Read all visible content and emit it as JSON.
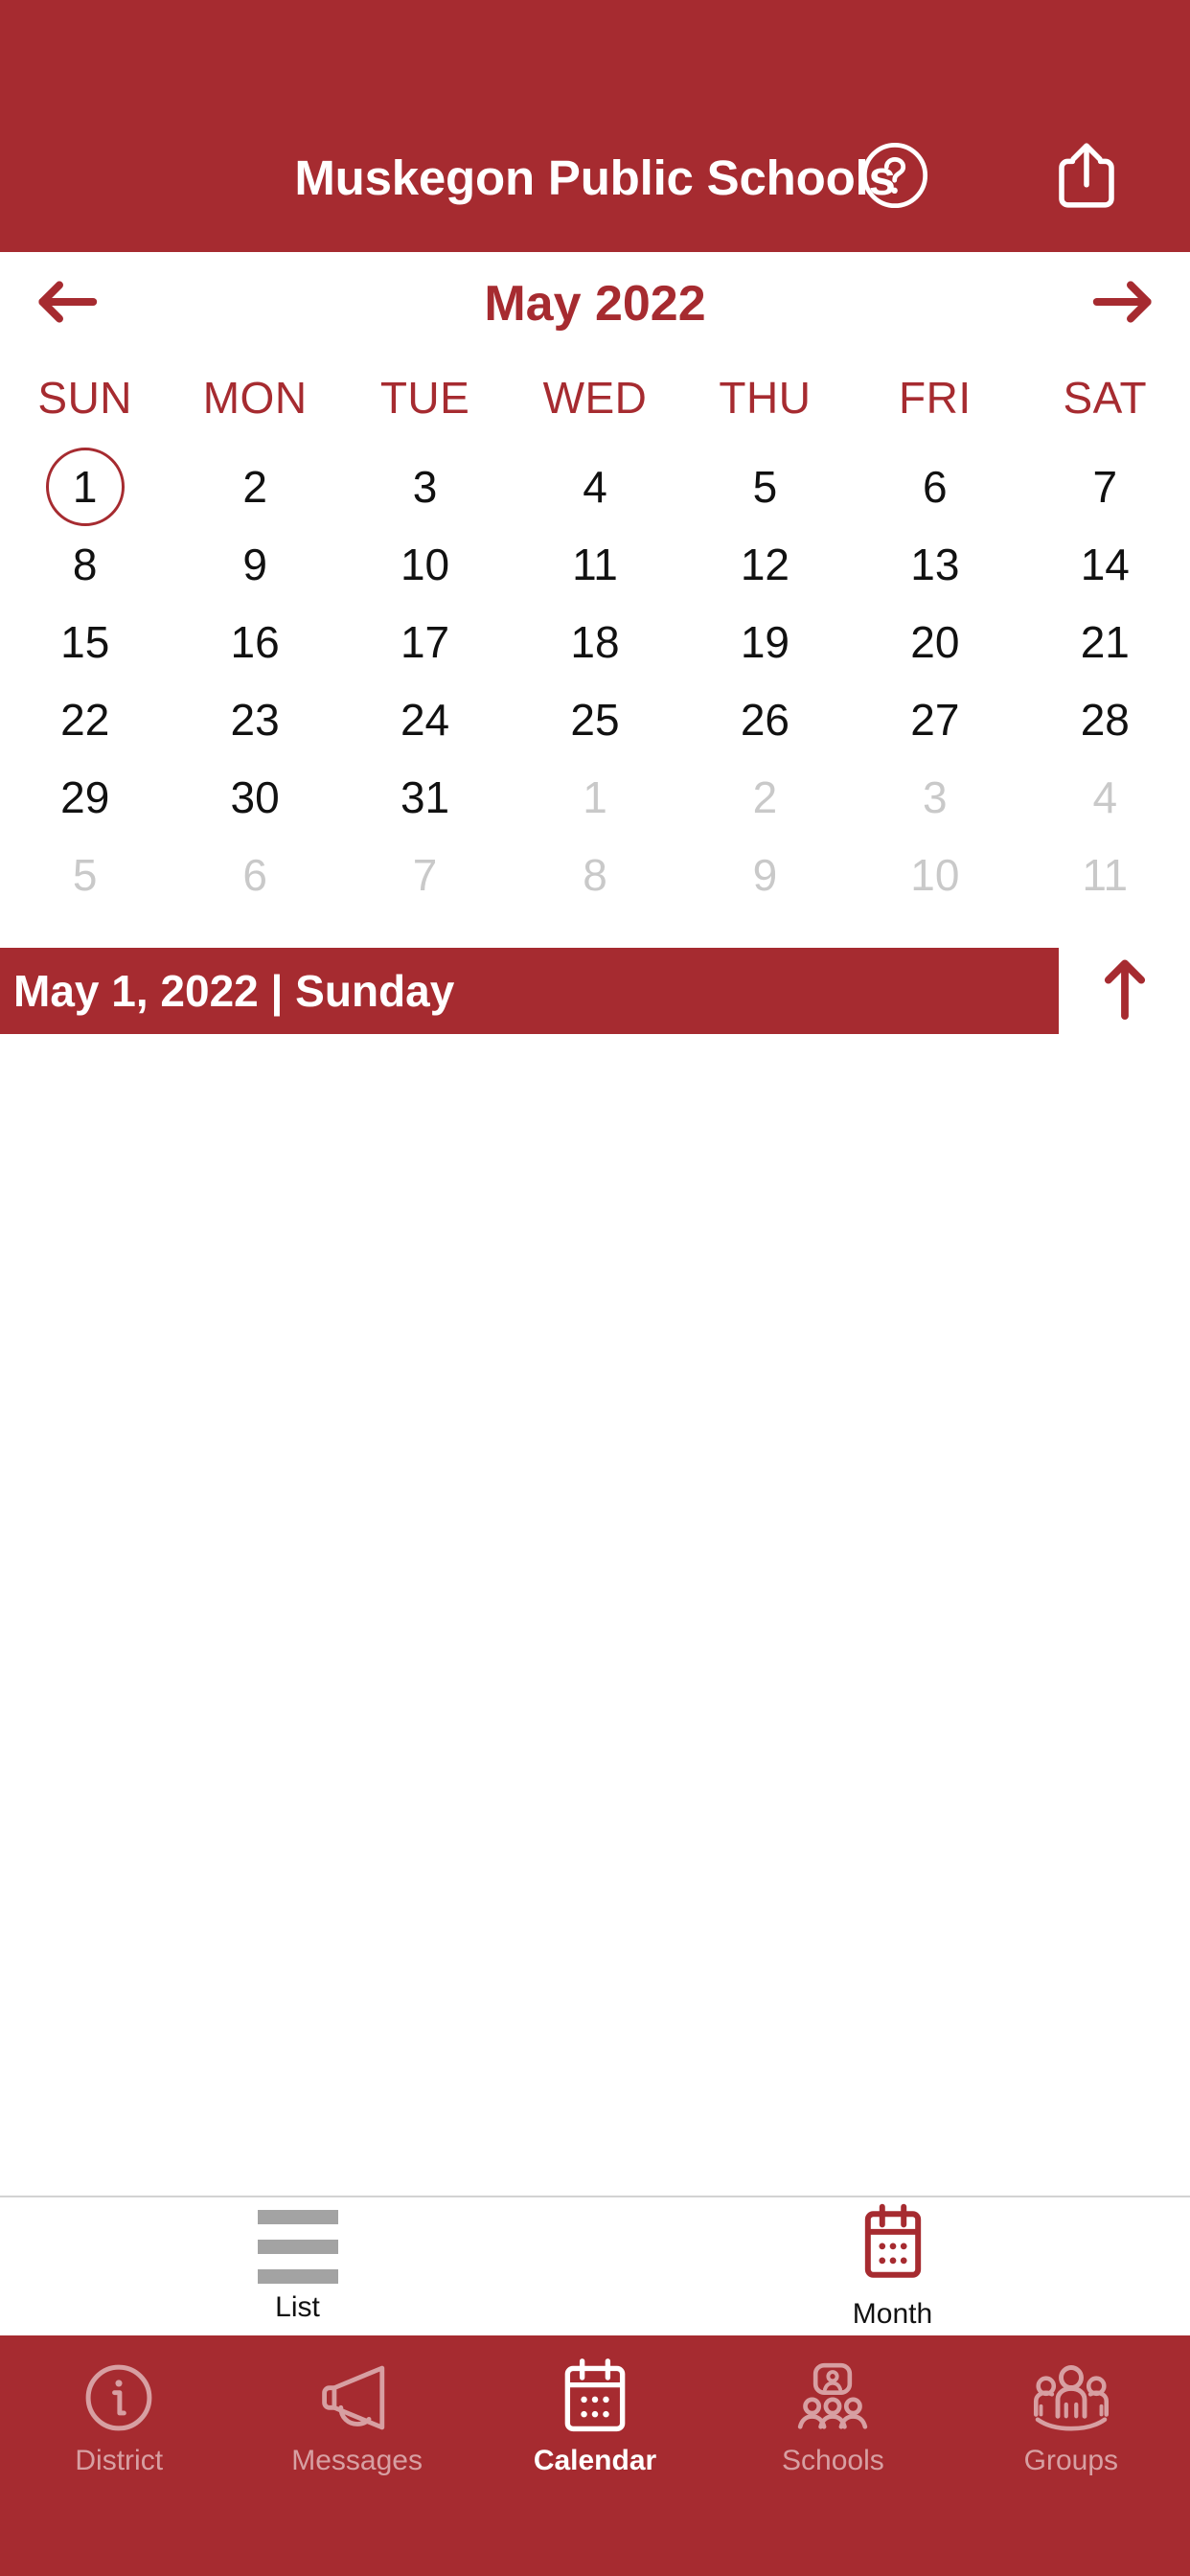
{
  "header": {
    "title": "Muskegon Public Schools",
    "help_icon": "question-circle-icon",
    "share_icon": "share-icon",
    "background_color": "#a62b30"
  },
  "calendar": {
    "month_title": "May 2022",
    "prev_label": "←",
    "next_label": "→",
    "weekdays": [
      "SUN",
      "MON",
      "TUE",
      "WED",
      "THU",
      "FRI",
      "SAT"
    ],
    "selected_day": 1,
    "weeks": [
      [
        {
          "n": "1",
          "muted": false,
          "selected": true
        },
        {
          "n": "2",
          "muted": false,
          "selected": false
        },
        {
          "n": "3",
          "muted": false,
          "selected": false
        },
        {
          "n": "4",
          "muted": false,
          "selected": false
        },
        {
          "n": "5",
          "muted": false,
          "selected": false
        },
        {
          "n": "6",
          "muted": false,
          "selected": false
        },
        {
          "n": "7",
          "muted": false,
          "selected": false
        }
      ],
      [
        {
          "n": "8",
          "muted": false,
          "selected": false
        },
        {
          "n": "9",
          "muted": false,
          "selected": false
        },
        {
          "n": "10",
          "muted": false,
          "selected": false
        },
        {
          "n": "11",
          "muted": false,
          "selected": false
        },
        {
          "n": "12",
          "muted": false,
          "selected": false
        },
        {
          "n": "13",
          "muted": false,
          "selected": false
        },
        {
          "n": "14",
          "muted": false,
          "selected": false
        }
      ],
      [
        {
          "n": "15",
          "muted": false,
          "selected": false
        },
        {
          "n": "16",
          "muted": false,
          "selected": false
        },
        {
          "n": "17",
          "muted": false,
          "selected": false
        },
        {
          "n": "18",
          "muted": false,
          "selected": false
        },
        {
          "n": "19",
          "muted": false,
          "selected": false
        },
        {
          "n": "20",
          "muted": false,
          "selected": false
        },
        {
          "n": "21",
          "muted": false,
          "selected": false
        }
      ],
      [
        {
          "n": "22",
          "muted": false,
          "selected": false
        },
        {
          "n": "23",
          "muted": false,
          "selected": false
        },
        {
          "n": "24",
          "muted": false,
          "selected": false
        },
        {
          "n": "25",
          "muted": false,
          "selected": false
        },
        {
          "n": "26",
          "muted": false,
          "selected": false
        },
        {
          "n": "27",
          "muted": false,
          "selected": false
        },
        {
          "n": "28",
          "muted": false,
          "selected": false
        }
      ],
      [
        {
          "n": "29",
          "muted": false,
          "selected": false
        },
        {
          "n": "30",
          "muted": false,
          "selected": false
        },
        {
          "n": "31",
          "muted": false,
          "selected": false
        },
        {
          "n": "1",
          "muted": true,
          "selected": false
        },
        {
          "n": "2",
          "muted": true,
          "selected": false
        },
        {
          "n": "3",
          "muted": true,
          "selected": false
        },
        {
          "n": "4",
          "muted": true,
          "selected": false
        }
      ],
      [
        {
          "n": "5",
          "muted": true,
          "selected": false
        },
        {
          "n": "6",
          "muted": true,
          "selected": false
        },
        {
          "n": "7",
          "muted": true,
          "selected": false
        },
        {
          "n": "8",
          "muted": true,
          "selected": false
        },
        {
          "n": "9",
          "muted": true,
          "selected": false
        },
        {
          "n": "10",
          "muted": true,
          "selected": false
        },
        {
          "n": "11",
          "muted": true,
          "selected": false
        }
      ]
    ]
  },
  "banner": {
    "text": "May 1, 2022 | Sunday",
    "scroll_up_icon": "arrow-up-icon",
    "background_color": "#a62b30"
  },
  "view_toggle": {
    "items": [
      {
        "label": "List",
        "icon": "list-lines-icon",
        "active": false
      },
      {
        "label": "Month",
        "icon": "calendar-month-icon",
        "active": true
      }
    ]
  },
  "tabbar": {
    "items": [
      {
        "label": "District",
        "icon": "info-circle-icon",
        "active": false
      },
      {
        "label": "Messages",
        "icon": "megaphone-icon",
        "active": false
      },
      {
        "label": "Calendar",
        "icon": "calendar-icon",
        "active": true
      },
      {
        "label": "Schools",
        "icon": "schools-icon",
        "active": false
      },
      {
        "label": "Groups",
        "icon": "groups-icon",
        "active": false
      }
    ],
    "background_color": "#a62b30"
  }
}
